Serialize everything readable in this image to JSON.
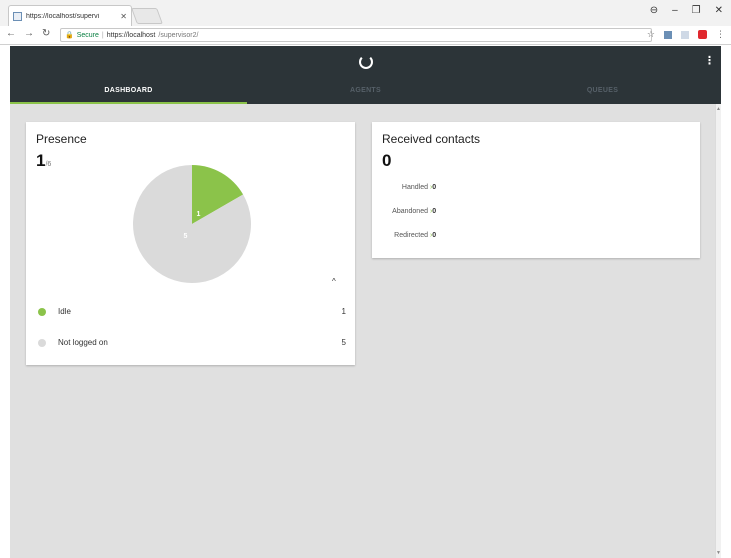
{
  "browser": {
    "tab_title": "https://localhost/supervi",
    "secure_label": "Secure",
    "url_host": "https://localhost",
    "url_path": "/supervisor2/"
  },
  "nav_tabs": [
    {
      "label": "DASHBOARD",
      "active": true
    },
    {
      "label": "AGENTS",
      "active": false
    },
    {
      "label": "QUEUES",
      "active": false
    }
  ],
  "presence": {
    "title": "Presence",
    "count": "1",
    "total": "/6",
    "legend": [
      {
        "label": "Idle",
        "value": "1",
        "color": "#8bc34a"
      },
      {
        "label": "Not logged on",
        "value": "5",
        "color": "#dadada"
      }
    ]
  },
  "received": {
    "title": "Received contacts",
    "count": "0",
    "rows": [
      {
        "label": "Handled",
        "value": "0"
      },
      {
        "label": "Abandoned",
        "value": "0"
      },
      {
        "label": "Redirected",
        "value": "0"
      }
    ]
  },
  "chart_data": {
    "type": "pie",
    "categories": [
      "Idle",
      "Not logged on"
    ],
    "values": [
      1,
      5
    ],
    "colors": [
      "#8bc34a",
      "#dadada"
    ],
    "data_labels": [
      "1",
      "5"
    ]
  },
  "colors": {
    "appbar": "#2c3438",
    "accent": "#8bc34a",
    "content_bg": "#e0e0e0"
  }
}
